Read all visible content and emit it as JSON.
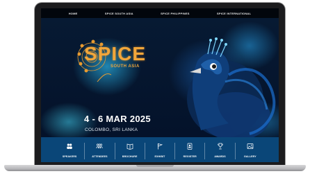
{
  "topnav": {
    "items": [
      {
        "label": "HOME"
      },
      {
        "label": "SPICE SOUTH ASIA"
      },
      {
        "label": "SPICE PHILIPPINES"
      },
      {
        "label": "SPICE INTERNATIONAL"
      }
    ]
  },
  "hero": {
    "logo_text": "SPICE",
    "logo_subtext": "SOUTH ASIA",
    "date": "4 - 6 MAR 2025",
    "location": "COLOMBO, SRI LANKA"
  },
  "bottombar": {
    "items": [
      {
        "label": "SPEAKERS",
        "icon": "speakers-icon"
      },
      {
        "label": "ATTENDEES",
        "icon": "attendees-icon"
      },
      {
        "label": "BROCHURE",
        "icon": "brochure-icon"
      },
      {
        "label": "EXHIBIT",
        "icon": "flag-icon"
      },
      {
        "label": "REGISTER",
        "icon": "register-icon"
      },
      {
        "label": "AWARDS",
        "icon": "trophy-icon"
      },
      {
        "label": "GALLERY",
        "icon": "gallery-icon"
      }
    ]
  },
  "colors": {
    "accent": "#f2a63a",
    "bar": "#0a4678",
    "nav": "#02060c"
  }
}
